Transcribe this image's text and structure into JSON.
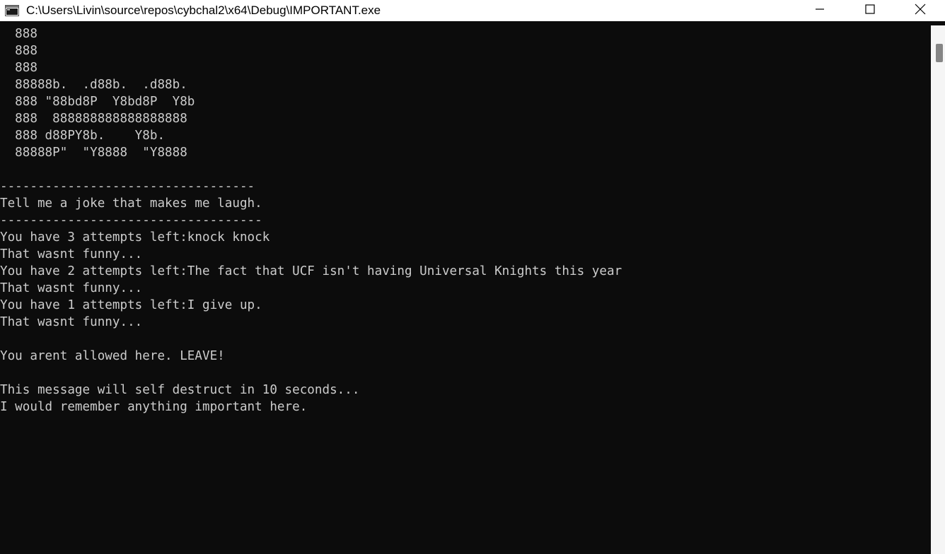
{
  "window": {
    "title": "C:\\Users\\Livin\\source\\repos\\cybchal2\\x64\\Debug\\IMPORTANT.exe",
    "app_icon": "console-app-icon",
    "controls": {
      "minimize_icon": "minimize-icon",
      "maximize_icon": "maximize-icon",
      "close_icon": "close-icon"
    }
  },
  "console": {
    "background": "#0c0c0c",
    "foreground": "#cccccc",
    "lines": [
      "  888",
      "  888",
      "  888",
      "  88888b.  .d88b.  .d88b.",
      "  888 \"88bd8P  Y8bd8P  Y8b",
      "  888  888888888888888888",
      "  888 d88PY8b.    Y8b.",
      "  88888P\"  \"Y8888  \"Y8888",
      "",
      "----------------------------------",
      "Tell me a joke that makes me laugh.",
      "-----------------------------------",
      "You have 3 attempts left:knock knock",
      "That wasnt funny...",
      "You have 2 attempts left:The fact that UCF isn't having Universal Knights this year",
      "That wasnt funny...",
      "You have 1 attempts left:I give up.",
      "That wasnt funny...",
      "",
      "You arent allowed here. LEAVE!",
      "",
      "This message will self destruct in 10 seconds...",
      "I would remember anything important here."
    ]
  }
}
